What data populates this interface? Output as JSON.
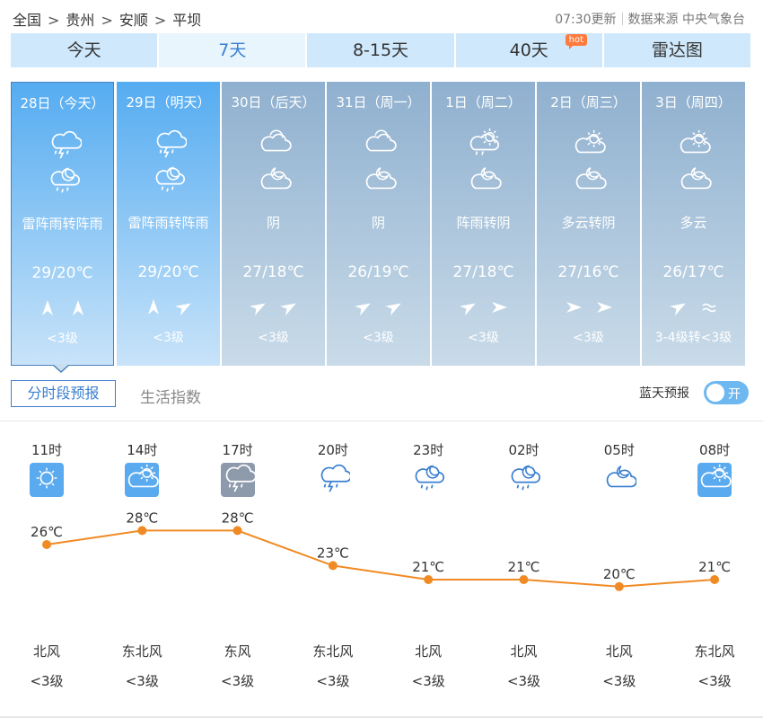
{
  "breadcrumb": [
    "全国",
    "贵州",
    "安顺",
    "平坝"
  ],
  "breadcrumb_sep": ">",
  "update_time": "07:30更新",
  "source": "数据来源 中央气象台",
  "tabs": [
    {
      "label": "今天"
    },
    {
      "label": "7天"
    },
    {
      "label": "8-15天"
    },
    {
      "label": "40天",
      "badge": "hot"
    },
    {
      "label": "雷达图"
    }
  ],
  "days": [
    {
      "date": "28日（今天）",
      "icon_day": "thunder-rain-icon",
      "icon_night": "rain-night-icon",
      "weather": "雷阵雨转阵雨",
      "temp": "29/20℃",
      "wind_day": "north-wind-icon",
      "wind_night": "north-wind-icon",
      "level": "<3级"
    },
    {
      "date": "29日（明天）",
      "icon_day": "thunder-rain-icon",
      "icon_night": "rain-night-icon",
      "weather": "雷阵雨转阵雨",
      "temp": "29/20℃",
      "wind_day": "north-wind-icon",
      "wind_night": "northeast-wind-icon",
      "level": "<3级"
    },
    {
      "date": "30日（后天）",
      "icon_day": "overcast-icon",
      "icon_night": "cloudy-night-icon",
      "weather": "阴",
      "temp": "27/18℃",
      "wind_day": "northeast-wind-icon",
      "wind_night": "northeast-wind-icon",
      "level": "<3级"
    },
    {
      "date": "31日（周一）",
      "icon_day": "overcast-icon",
      "icon_night": "cloudy-night-icon",
      "weather": "阴",
      "temp": "26/19℃",
      "wind_day": "northeast-wind-icon",
      "wind_night": "northeast-wind-icon",
      "level": "<3级"
    },
    {
      "date": "1日（周二）",
      "icon_day": "shower-sun-icon",
      "icon_night": "cloudy-night-icon",
      "weather": "阵雨转阴",
      "temp": "27/18℃",
      "wind_day": "northeast-wind-icon",
      "wind_night": "east-wind-icon",
      "level": "<3级"
    },
    {
      "date": "2日（周三）",
      "icon_day": "partly-cloudy-icon",
      "icon_night": "cloudy-night-icon",
      "weather": "多云转阴",
      "temp": "27/16℃",
      "wind_day": "east-wind-icon",
      "wind_night": "east-wind-icon",
      "level": "<3级"
    },
    {
      "date": "3日（周四）",
      "icon_day": "partly-cloudy-icon",
      "icon_night": "cloudy-night-icon",
      "weather": "多云",
      "temp": "26/17℃",
      "wind_day": "northeast-wind-icon",
      "wind_night": "variable-wind-icon",
      "level": "3-4级转<3级"
    }
  ],
  "subtabs": {
    "hourly": "分时段预报",
    "life": "生活指数"
  },
  "bluesky": {
    "label": "蓝天预报",
    "toggle": "开"
  },
  "hourly": [
    {
      "time": "11时",
      "icon": "sunny-icon",
      "temp": 26,
      "temp_label": "26℃",
      "wind": "北风",
      "level": "<3级"
    },
    {
      "time": "14时",
      "icon": "partly-cloudy-icon",
      "temp": 28,
      "temp_label": "28℃",
      "wind": "东北风",
      "level": "<3级"
    },
    {
      "time": "17时",
      "icon": "thunder-rain-icon",
      "temp": 28,
      "temp_label": "28℃",
      "wind": "东风",
      "level": "<3级"
    },
    {
      "time": "20时",
      "icon": "thunder-rain-icon",
      "temp": 23,
      "temp_label": "23℃",
      "wind": "东北风",
      "level": "<3级"
    },
    {
      "time": "23时",
      "icon": "rain-night-icon",
      "temp": 21,
      "temp_label": "21℃",
      "wind": "北风",
      "level": "<3级"
    },
    {
      "time": "02时",
      "icon": "rain-night-icon",
      "temp": 21,
      "temp_label": "21℃",
      "wind": "北风",
      "level": "<3级"
    },
    {
      "time": "05时",
      "icon": "cloudy-night-icon",
      "temp": 20,
      "temp_label": "20℃",
      "wind": "北风",
      "level": "<3级"
    },
    {
      "time": "08时",
      "icon": "partly-cloudy-icon",
      "temp": 21,
      "temp_label": "21℃",
      "wind": "东北风",
      "level": "<3级"
    }
  ],
  "colors": {
    "accent": "#3a7fd0",
    "temp_line": "#f08a24",
    "tab_bg": "#cfe8fb",
    "day_sunny": "#55acf1",
    "day_cloudy": "#8fb0cf",
    "hot_badge": "#ff7a3d"
  }
}
